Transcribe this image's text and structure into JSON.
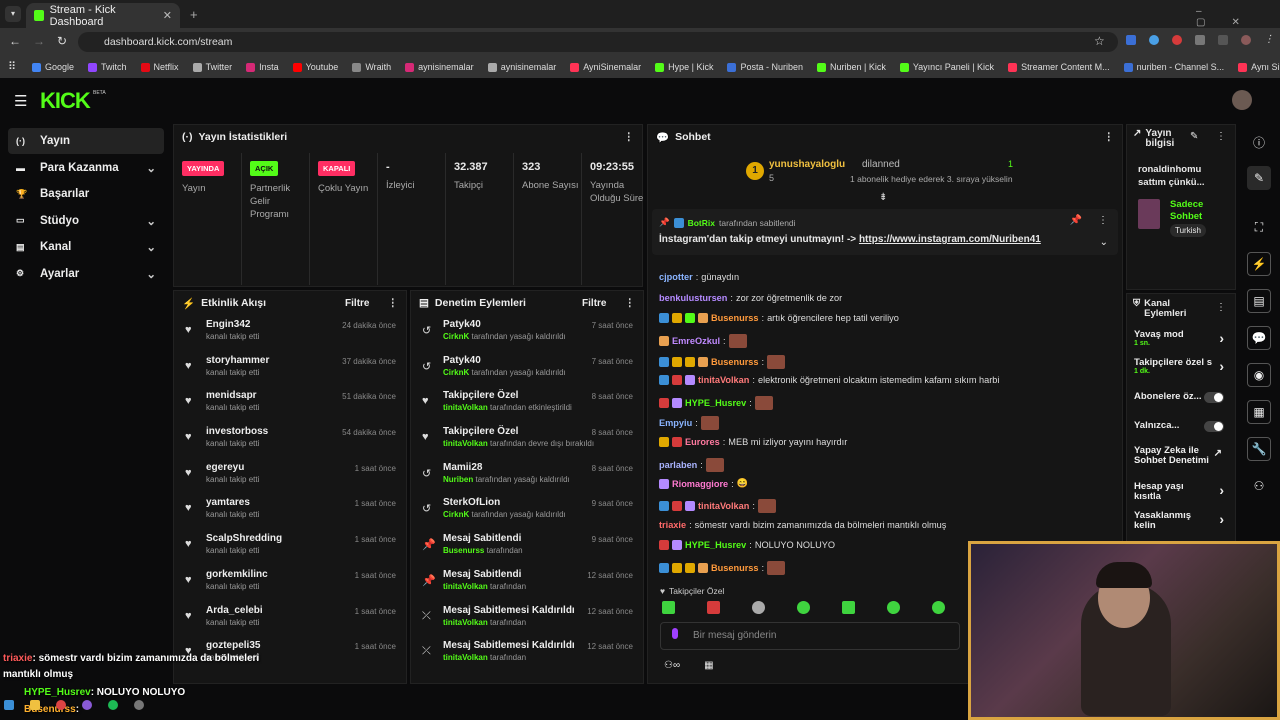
{
  "browser": {
    "tab_title": "Stream - Kick Dashboard",
    "url": "dashboard.kick.com/stream",
    "bookmarks": [
      "Google",
      "Twitch",
      "Netflix",
      "Twitter",
      "Insta",
      "Youtube",
      "Wraith",
      "aynisinemalar",
      "aynisinemalar",
      "AyniSinemalar",
      "Hype | Kick",
      "Posta - Nuriben",
      "Nuriben | Kick",
      "Yayıncı Paneli | Kick",
      "Streamer Content M...",
      "nuriben - Channel S...",
      "Aynı Sinemalar - Ça..."
    ]
  },
  "brand": {
    "logo": "KICK",
    "beta": "BETA",
    "accent": "#53fc18"
  },
  "nav": [
    {
      "label": "Yayın",
      "icon": "broadcast-icon"
    },
    {
      "label": "Para Kazanma",
      "icon": "wallet-icon"
    },
    {
      "label": "Başarılar",
      "icon": "trophy-icon"
    },
    {
      "label": "Stüdyo",
      "icon": "studio-icon"
    },
    {
      "label": "Kanal",
      "icon": "channel-icon"
    },
    {
      "label": "Ayarlar",
      "icon": "gear-icon"
    }
  ],
  "stats": {
    "title": "Yayın İstatistikleri",
    "cols": [
      {
        "badge": "YAYINDA",
        "label": "Yayın"
      },
      {
        "badge": "AÇIK",
        "label": "Partnerlik Gelir Programı"
      },
      {
        "badge": "KAPALI",
        "label": "Çoklu Yayın"
      },
      {
        "value": "-",
        "label": "İzleyici"
      },
      {
        "value": "32.387",
        "label": "Takipçi"
      },
      {
        "value": "323",
        "label": "Abone Sayısı"
      },
      {
        "value": "09:23:55",
        "label": "Yayında Olduğu Süre"
      }
    ]
  },
  "feed": {
    "title": "Etkinlik Akışı",
    "filter": "Filtre",
    "items": [
      {
        "name": "Engin342",
        "sub": "kanalı takip etti",
        "time": "24 dakika önce"
      },
      {
        "name": "storyhammer",
        "sub": "kanalı takip etti",
        "time": "37 dakika önce"
      },
      {
        "name": "menidsapr",
        "sub": "kanalı takip etti",
        "time": "51 dakika önce"
      },
      {
        "name": "investorboss",
        "sub": "kanalı takip etti",
        "time": "54 dakika önce"
      },
      {
        "name": "egereyu",
        "sub": "kanalı takip etti",
        "time": "1 saat önce"
      },
      {
        "name": "yamtares",
        "sub": "kanalı takip etti",
        "time": "1 saat önce"
      },
      {
        "name": "ScalpShredding",
        "sub": "kanalı takip etti",
        "time": "1 saat önce"
      },
      {
        "name": "gorkemkilinc",
        "sub": "kanalı takip etti",
        "time": "1 saat önce"
      },
      {
        "name": "Arda_celebi",
        "sub": "kanalı takip etti",
        "time": "1 saat önce"
      },
      {
        "name": "goztepeli35",
        "sub": "kanalı takip etti",
        "time": "1 saat önce"
      }
    ]
  },
  "mod": {
    "title": "Denetim Eylemleri",
    "filter": "Filtre",
    "items": [
      {
        "name": "Patyk40",
        "who": "CirknK",
        "sub": "tarafından yasağı kaldırıldı",
        "time": "7 saat önce",
        "icon": "undo-icon"
      },
      {
        "name": "Patyk40",
        "who": "CirknK",
        "sub": "tarafından yasağı kaldırıldı",
        "time": "7 saat önce",
        "icon": "undo-icon"
      },
      {
        "name": "Takipçilere Özel",
        "who": "tinitaVolkan",
        "sub": "tarafından etkinleştirildi",
        "time": "8 saat önce",
        "icon": "heart-icon"
      },
      {
        "name": "Takipçilere Özel",
        "who": "tinitaVolkan",
        "sub": "tarafından devre dışı bırakıldı",
        "time": "8 saat önce",
        "icon": "heart-icon"
      },
      {
        "name": "Mamii28",
        "who": "Nuriben",
        "sub": "tarafından yasağı kaldırıldı",
        "time": "8 saat önce",
        "icon": "undo-icon"
      },
      {
        "name": "SterkOfLion",
        "who": "CirknK",
        "sub": "tarafından yasağı kaldırıldı",
        "time": "9 saat önce",
        "icon": "undo-icon"
      },
      {
        "name": "Mesaj Sabitlendi",
        "who": "Busenurss",
        "sub": "tarafından",
        "time": "9 saat önce",
        "icon": "pin-icon"
      },
      {
        "name": "Mesaj Sabitlendi",
        "who": "tinitaVolkan",
        "sub": "tarafından",
        "time": "12 saat önce",
        "icon": "pin-icon"
      },
      {
        "name": "Mesaj Sabitlemesi Kaldırıldı",
        "who": "tinitaVolkan",
        "sub": "tarafından",
        "time": "12 saat önce",
        "icon": "unpin-icon"
      },
      {
        "name": "Mesaj Sabitlemesi Kaldırıldı",
        "who": "tinitaVolkan",
        "sub": "tarafından",
        "time": "12 saat önce",
        "icon": "unpin-icon"
      }
    ]
  },
  "chat": {
    "title": "Sohbet",
    "gift": {
      "user": "yunushayaloglu",
      "count": "5",
      "rank": "1",
      "recipient": "dilanned",
      "recipient_count": "1",
      "note": "1 abonelik hediye ederek 3. sıraya yükselin"
    },
    "pinned": {
      "by": "BotRix",
      "by_suffix": "tarafından sabitlendi",
      "text": "İnstagram'dan takip etmeyi unutmayın! ->",
      "link": "https://www.instagram.com/Nuriben41"
    },
    "messages": [
      {
        "user": "cjpotter",
        "color": "#8ab4ff",
        "text": "günaydın"
      },
      {
        "user": "benkulustursen",
        "color": "#b48aff",
        "text": "zor zor öğretmenlik de zor"
      },
      {
        "user": "Busenurss",
        "color": "#ff9a3c",
        "text": "artık öğrencilere hep tatil veriliyo"
      },
      {
        "user": "EmreOzkul",
        "color": "#c08aff",
        "text": ""
      },
      {
        "user": "Busenurss",
        "color": "#ff9a3c",
        "text": ""
      },
      {
        "user": "tinitaVolkan",
        "color": "#ff7a7a",
        "text": "elektronik öğretmeni olcaktım istemedim kafamı sıkım harbi"
      },
      {
        "user": "HYPE_Husrev",
        "color": "#53fc18",
        "text": ""
      },
      {
        "user": "Empyiu",
        "color": "#8ab4ff",
        "text": ""
      },
      {
        "user": "Eurores",
        "color": "#ff7aa0",
        "text": "MEB mi izliyor yayını hayırdır"
      },
      {
        "user": "parlaben",
        "color": "#aab4ff",
        "text": ""
      },
      {
        "user": "Riomaggiore",
        "color": "#ff7ad0",
        "text": "😄"
      },
      {
        "user": "tinitaVolkan",
        "color": "#ff7a7a",
        "text": ""
      },
      {
        "user": "triaxie",
        "color": "#ff6a6a",
        "text": "sömestr vardı bizim zamanımızda da bölmeleri mantıklı olmuş"
      },
      {
        "user": "HYPE_Husrev",
        "color": "#53fc18",
        "text": "NOLUYO NOLUYO"
      },
      {
        "user": "Busenurss",
        "color": "#ff9a3c",
        "text": ""
      }
    ],
    "follower_only": "Takipçiler Özel",
    "placeholder": "Bir mesaj gönderin"
  },
  "info": {
    "title": "Yayın bilgisi",
    "stream_title": "ronaldinhomu sattım çünkü...",
    "category": "Sadece Sohbet",
    "language": "Turkish"
  },
  "actions": {
    "title": "Kanal Eylemleri",
    "items": [
      {
        "label": "Yavaş mod",
        "value": "1 sn.",
        "kind": "chevron"
      },
      {
        "label": "Takipçilere özel s",
        "value": "1 dk.",
        "kind": "chevron"
      },
      {
        "label": "Abonelere öz...",
        "kind": "toggle"
      },
      {
        "label": "Yalnızca...",
        "kind": "toggle"
      },
      {
        "label": "Yapay Zeka ile Sohbet Denetimi",
        "kind": "external"
      },
      {
        "label": "Hesap yaşı kısıtla",
        "kind": "chevron"
      },
      {
        "label": "Yasaklanmış kelin",
        "kind": "chevron"
      }
    ]
  },
  "overlay": {
    "lines": [
      {
        "user": "triaxie",
        "text": ": sömestr vardı bizim zamanımızda da bölmeleri"
      },
      {
        "user": "",
        "text": "mantıklı olmuş"
      },
      {
        "user": "HYPE_Husrev",
        "text": ": NOLUYO NOLUYO"
      },
      {
        "user": "Busenurss",
        "text": ":"
      }
    ]
  }
}
